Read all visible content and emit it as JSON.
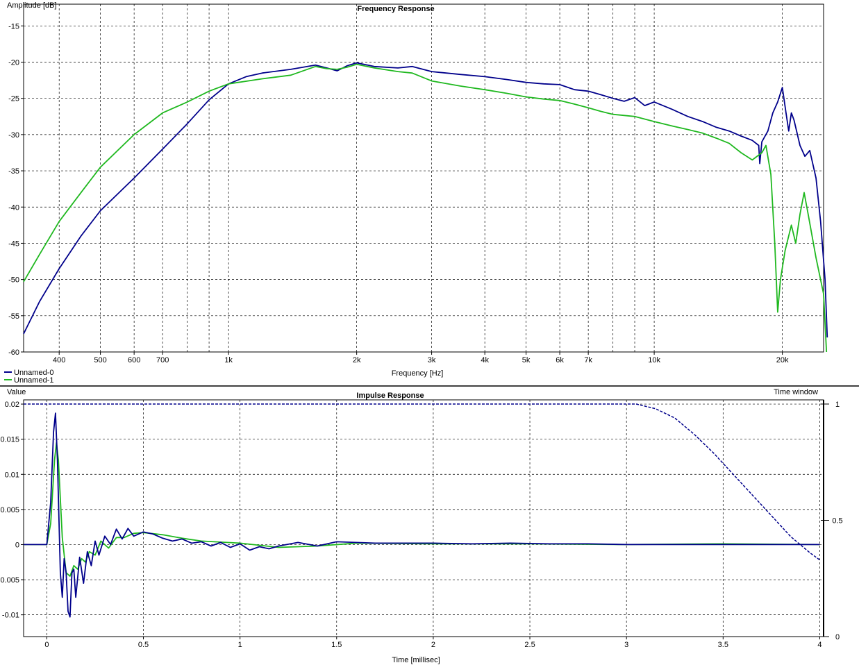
{
  "chart_data": [
    {
      "type": "line",
      "title": "Frequency Response",
      "ylabel": "Amplitude [dB]",
      "xlabel": "Frequency [Hz]",
      "xscale": "log",
      "xlim": [
        330,
        25000
      ],
      "ylim": [
        -60,
        -12
      ],
      "grid": true,
      "legend_position": "bottom-left",
      "yticks": [
        -15,
        -20,
        -25,
        -30,
        -35,
        -40,
        -45,
        -50,
        -55,
        -60
      ],
      "xticks": [
        {
          "v": 400,
          "label": "400"
        },
        {
          "v": 500,
          "label": "500"
        },
        {
          "v": 600,
          "label": "600"
        },
        {
          "v": 700,
          "label": "700"
        },
        {
          "v": 1000,
          "label": "1k"
        },
        {
          "v": 2000,
          "label": "2k"
        },
        {
          "v": 3000,
          "label": "3k"
        },
        {
          "v": 4000,
          "label": "4k"
        },
        {
          "v": 5000,
          "label": "5k"
        },
        {
          "v": 6000,
          "label": "6k"
        },
        {
          "v": 7000,
          "label": "7k"
        },
        {
          "v": 10000,
          "label": "10k"
        },
        {
          "v": 20000,
          "label": "20k"
        }
      ],
      "minor_gridlines": [
        800,
        900,
        8000,
        9000
      ],
      "series": [
        {
          "name": "Unnamed-0",
          "color": "#00008b",
          "points": [
            [
              330,
              -57.5
            ],
            [
              360,
              -53
            ],
            [
              400,
              -48.5
            ],
            [
              450,
              -44
            ],
            [
              500,
              -40.5
            ],
            [
              600,
              -36
            ],
            [
              700,
              -32
            ],
            [
              800,
              -28.5
            ],
            [
              900,
              -25.2
            ],
            [
              1000,
              -23
            ],
            [
              1100,
              -22
            ],
            [
              1200,
              -21.5
            ],
            [
              1400,
              -21
            ],
            [
              1600,
              -20.4
            ],
            [
              1700,
              -20.8
            ],
            [
              1800,
              -21.2
            ],
            [
              1900,
              -20.5
            ],
            [
              2000,
              -20.1
            ],
            [
              2200,
              -20.6
            ],
            [
              2500,
              -20.8
            ],
            [
              2700,
              -20.6
            ],
            [
              3000,
              -21.3
            ],
            [
              3500,
              -21.7
            ],
            [
              4000,
              -22
            ],
            [
              4500,
              -22.4
            ],
            [
              5000,
              -22.8
            ],
            [
              5500,
              -23
            ],
            [
              6000,
              -23.1
            ],
            [
              6500,
              -23.8
            ],
            [
              7000,
              -24
            ],
            [
              7500,
              -24.5
            ],
            [
              8000,
              -25
            ],
            [
              8500,
              -25.4
            ],
            [
              9000,
              -24.9
            ],
            [
              9500,
              -26
            ],
            [
              10000,
              -25.5
            ],
            [
              11000,
              -26.5
            ],
            [
              12000,
              -27.5
            ],
            [
              13000,
              -28.2
            ],
            [
              14000,
              -29
            ],
            [
              15000,
              -29.5
            ],
            [
              16000,
              -30.2
            ],
            [
              17000,
              -30.8
            ],
            [
              17600,
              -31.5
            ],
            [
              17700,
              -34
            ],
            [
              17900,
              -31
            ],
            [
              18500,
              -29.5
            ],
            [
              19000,
              -27
            ],
            [
              19500,
              -25.5
            ],
            [
              20000,
              -23.5
            ],
            [
              20400,
              -27
            ],
            [
              20700,
              -29.5
            ],
            [
              21000,
              -27
            ],
            [
              21300,
              -28
            ],
            [
              22000,
              -31.5
            ],
            [
              22600,
              -33
            ],
            [
              23200,
              -32.2
            ],
            [
              24000,
              -36
            ],
            [
              24600,
              -42
            ],
            [
              25200,
              -50
            ],
            [
              25500,
              -58
            ]
          ]
        },
        {
          "name": "Unnamed-1",
          "color": "#1fb81f",
          "points": [
            [
              330,
              -50.3
            ],
            [
              360,
              -46.5
            ],
            [
              400,
              -42
            ],
            [
              450,
              -38
            ],
            [
              500,
              -34.5
            ],
            [
              600,
              -30
            ],
            [
              700,
              -27
            ],
            [
              800,
              -25.5
            ],
            [
              900,
              -24
            ],
            [
              1000,
              -23
            ],
            [
              1200,
              -22.3
            ],
            [
              1400,
              -21.8
            ],
            [
              1600,
              -20.6
            ],
            [
              1700,
              -20.9
            ],
            [
              1800,
              -21
            ],
            [
              1900,
              -20.7
            ],
            [
              2000,
              -20.3
            ],
            [
              2200,
              -20.8
            ],
            [
              2500,
              -21.3
            ],
            [
              2700,
              -21.5
            ],
            [
              3000,
              -22.6
            ],
            [
              3500,
              -23.3
            ],
            [
              4000,
              -23.8
            ],
            [
              4500,
              -24.3
            ],
            [
              5000,
              -24.8
            ],
            [
              5500,
              -25.1
            ],
            [
              6000,
              -25.3
            ],
            [
              6500,
              -25.8
            ],
            [
              7000,
              -26.3
            ],
            [
              7500,
              -26.8
            ],
            [
              8000,
              -27.2
            ],
            [
              9000,
              -27.5
            ],
            [
              10000,
              -28.2
            ],
            [
              11000,
              -28.8
            ],
            [
              12000,
              -29.3
            ],
            [
              13000,
              -29.8
            ],
            [
              14000,
              -30.5
            ],
            [
              15000,
              -31.2
            ],
            [
              16000,
              -32.5
            ],
            [
              17000,
              -33.5
            ],
            [
              17900,
              -32.5
            ],
            [
              18300,
              -31.5
            ],
            [
              18800,
              -35.5
            ],
            [
              19200,
              -45
            ],
            [
              19500,
              -54.5
            ],
            [
              19800,
              -50
            ],
            [
              20300,
              -46
            ],
            [
              21000,
              -42.5
            ],
            [
              21500,
              -45
            ],
            [
              22000,
              -41
            ],
            [
              22500,
              -38
            ],
            [
              23000,
              -41
            ],
            [
              24000,
              -47
            ],
            [
              25000,
              -52
            ],
            [
              25400,
              -60
            ]
          ]
        }
      ]
    },
    {
      "type": "line",
      "title": "Impulse Response",
      "ylabel": "Value",
      "y2label": "Time window",
      "xlabel": "Time [millisec]",
      "xlim": [
        -0.12,
        4.02
      ],
      "ylim": [
        -0.0131,
        0.0206
      ],
      "y2lim": [
        0,
        1
      ],
      "grid": true,
      "yticks": [
        0.02,
        0.015,
        0.01,
        0.005,
        0,
        -0.005,
        -0.01
      ],
      "ytick_labels": [
        "0.02",
        "0.015",
        "0.01",
        "0.005",
        "0",
        "-0.005",
        "-0.01"
      ],
      "y2ticks": [
        1,
        0.5,
        0
      ],
      "y2tick_labels": [
        "1",
        "0.5",
        "0"
      ],
      "xticks": [
        0,
        0.5,
        1,
        1.5,
        2,
        2.5,
        3,
        3.5,
        4
      ],
      "xtick_labels": [
        "0",
        "0.5",
        "1",
        "1.5",
        "2",
        "2.5",
        "3",
        "3.5",
        "4"
      ],
      "series": [
        {
          "name": "Unnamed-1",
          "color": "#1fb81f",
          "points": [
            [
              -0.12,
              0
            ],
            [
              0,
              0
            ],
            [
              0.02,
              0.003
            ],
            [
              0.04,
              0.012
            ],
            [
              0.05,
              0.0145
            ],
            [
              0.06,
              0.012
            ],
            [
              0.08,
              0.001
            ],
            [
              0.1,
              -0.004
            ],
            [
              0.12,
              -0.0045
            ],
            [
              0.14,
              -0.003
            ],
            [
              0.16,
              -0.0035
            ],
            [
              0.18,
              -0.002
            ],
            [
              0.2,
              -0.0025
            ],
            [
              0.22,
              -0.001
            ],
            [
              0.25,
              -0.0015
            ],
            [
              0.28,
              0.0005
            ],
            [
              0.32,
              -0.0005
            ],
            [
              0.36,
              0.001
            ],
            [
              0.4,
              0.001
            ],
            [
              0.45,
              0.0016
            ],
            [
              0.5,
              0.0017
            ],
            [
              0.6,
              0.0014
            ],
            [
              0.7,
              0.0009
            ],
            [
              0.8,
              0.0005
            ],
            [
              1,
              0.0002
            ],
            [
              1.2,
              -0.0004
            ],
            [
              1.4,
              -0.0002
            ],
            [
              1.6,
              0.0002
            ],
            [
              2,
              0.0001
            ],
            [
              2.5,
              0.0001
            ],
            [
              3,
              0
            ],
            [
              3.5,
              0.0001
            ],
            [
              4,
              0
            ]
          ]
        },
        {
          "name": "Unnamed-0",
          "color": "#00008b",
          "points": [
            [
              -0.12,
              0
            ],
            [
              0,
              0
            ],
            [
              0.02,
              0.006
            ],
            [
              0.035,
              0.016
            ],
            [
              0.045,
              0.0187
            ],
            [
              0.055,
              0.012
            ],
            [
              0.07,
              -0.004
            ],
            [
              0.08,
              -0.0075
            ],
            [
              0.09,
              -0.002
            ],
            [
              0.1,
              -0.004
            ],
            [
              0.11,
              -0.0095
            ],
            [
              0.12,
              -0.0103
            ],
            [
              0.13,
              -0.004
            ],
            [
              0.14,
              -0.0035
            ],
            [
              0.15,
              -0.0075
            ],
            [
              0.17,
              -0.0018
            ],
            [
              0.19,
              -0.0055
            ],
            [
              0.21,
              -0.001
            ],
            [
              0.23,
              -0.003
            ],
            [
              0.25,
              0.0005
            ],
            [
              0.27,
              -0.0015
            ],
            [
              0.3,
              0.0012
            ],
            [
              0.33,
              0
            ],
            [
              0.36,
              0.0022
            ],
            [
              0.39,
              0.0008
            ],
            [
              0.42,
              0.0023
            ],
            [
              0.45,
              0.0012
            ],
            [
              0.5,
              0.0018
            ],
            [
              0.55,
              0.0015
            ],
            [
              0.6,
              0.0009
            ],
            [
              0.65,
              0.0005
            ],
            [
              0.7,
              0.0008
            ],
            [
              0.75,
              0.0002
            ],
            [
              0.8,
              0.0004
            ],
            [
              0.85,
              -0.0002
            ],
            [
              0.9,
              0.0003
            ],
            [
              0.95,
              -0.0004
            ],
            [
              1,
              0.0001
            ],
            [
              1.05,
              -0.0008
            ],
            [
              1.1,
              -0.0003
            ],
            [
              1.15,
              -0.0006
            ],
            [
              1.2,
              -0.0002
            ],
            [
              1.3,
              0.0003
            ],
            [
              1.4,
              -0.0002
            ],
            [
              1.5,
              0.0004
            ],
            [
              1.6,
              0.0003
            ],
            [
              1.7,
              0.0002
            ],
            [
              1.8,
              0.0002
            ],
            [
              2,
              0.0002
            ],
            [
              2.2,
              0.0001
            ],
            [
              2.4,
              0.0002
            ],
            [
              2.6,
              0.0001
            ],
            [
              2.8,
              0.0001
            ],
            [
              3,
              0
            ],
            [
              3.5,
              0
            ],
            [
              4,
              0
            ]
          ]
        },
        {
          "name": "Time window",
          "color": "#00008b",
          "dashed": true,
          "axis": "y2",
          "points": [
            [
              -0.12,
              1
            ],
            [
              3.05,
              1
            ],
            [
              3.15,
              0.98
            ],
            [
              3.25,
              0.94
            ],
            [
              3.35,
              0.87
            ],
            [
              3.45,
              0.79
            ],
            [
              3.55,
              0.7
            ],
            [
              3.65,
              0.61
            ],
            [
              3.75,
              0.52
            ],
            [
              3.85,
              0.43
            ],
            [
              3.95,
              0.36
            ],
            [
              4,
              0.33
            ]
          ]
        }
      ]
    }
  ]
}
